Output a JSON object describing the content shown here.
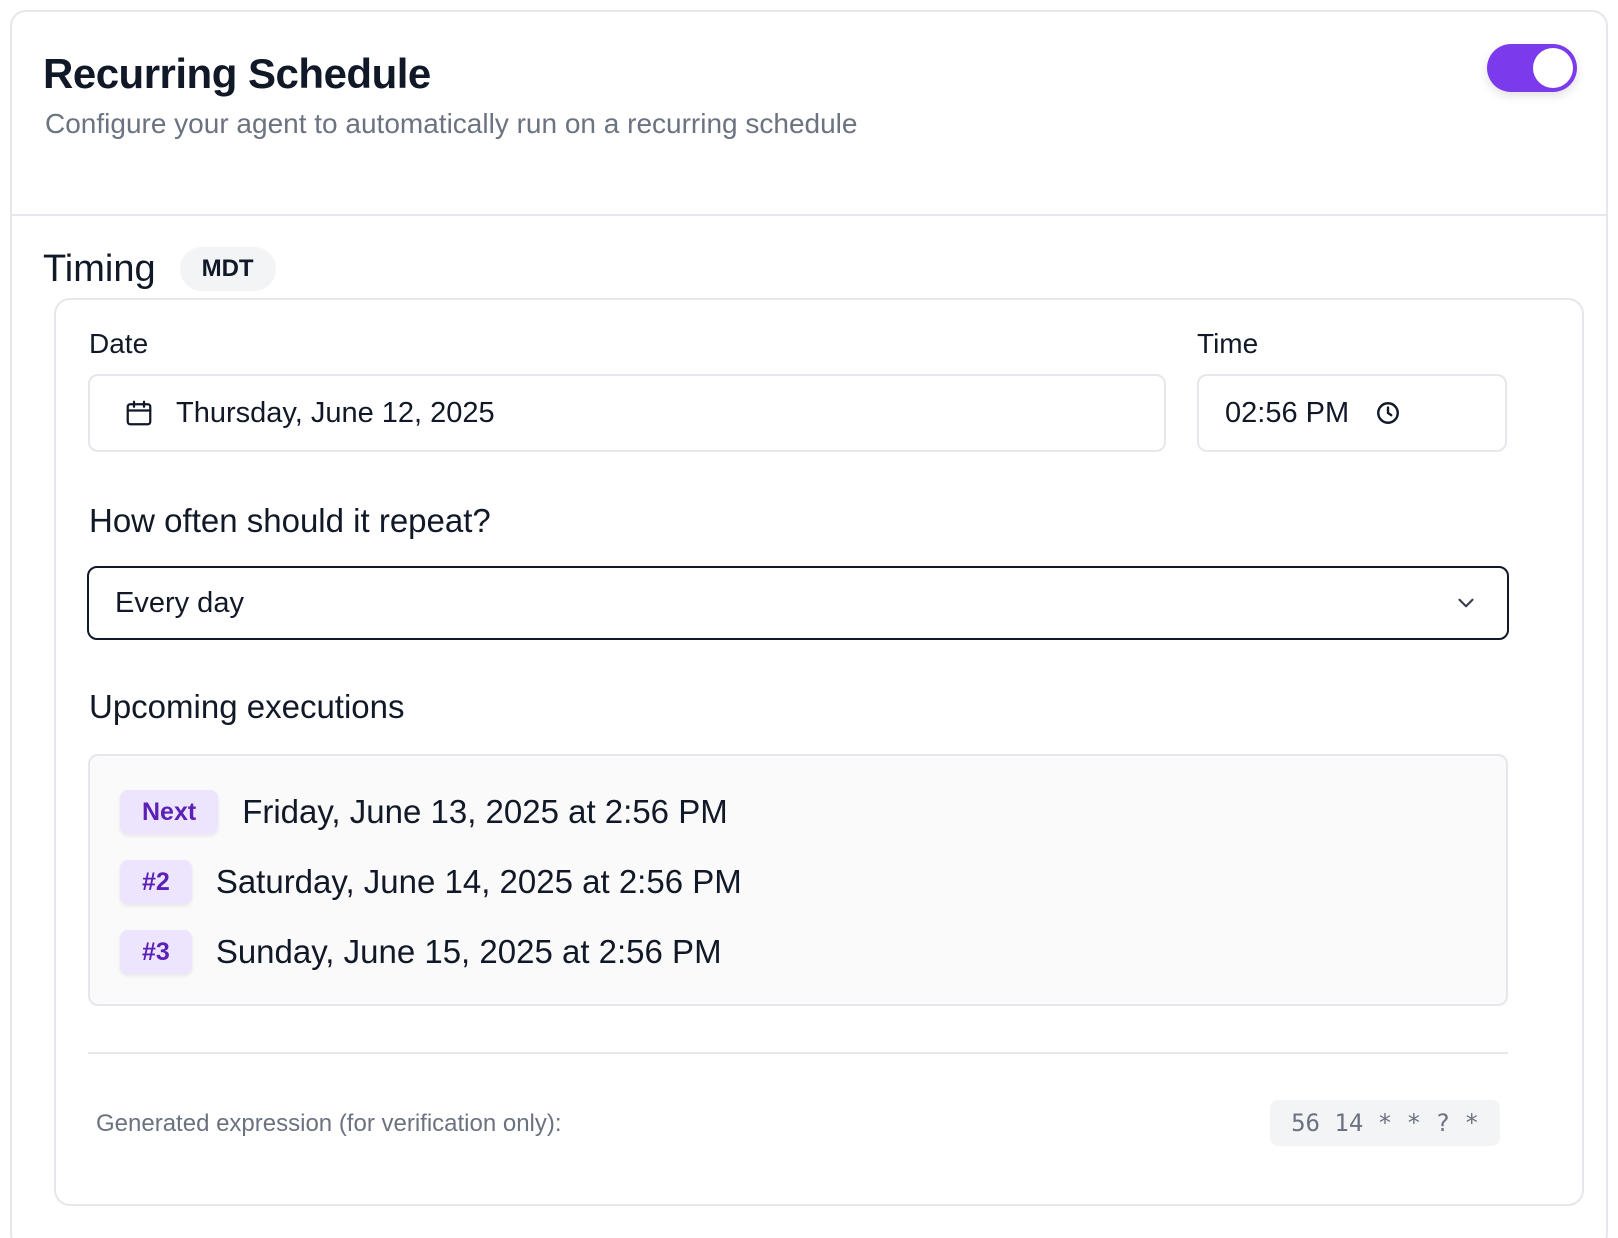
{
  "header": {
    "title": "Recurring Schedule",
    "subtitle": "Configure your agent to automatically run on a recurring schedule",
    "toggle_enabled": true,
    "accent_color": "#7c3aed"
  },
  "timing": {
    "label": "Timing",
    "timezone": "MDT"
  },
  "date_field": {
    "label": "Date",
    "value": "Thursday, June 12, 2025",
    "icon": "calendar-icon"
  },
  "time_field": {
    "label": "Time",
    "value": "02:56 PM",
    "icon": "clock-icon"
  },
  "repeat": {
    "label": "How often should it repeat?",
    "selected": "Every day",
    "icon": "chevron-down-icon"
  },
  "upcoming": {
    "label": "Upcoming executions",
    "items": [
      {
        "badge": "Next",
        "text": "Friday, June 13, 2025 at 2:56 PM"
      },
      {
        "badge": "#2",
        "text": "Saturday, June 14, 2025 at 2:56 PM"
      },
      {
        "badge": "#3",
        "text": "Sunday, June 15, 2025 at 2:56 PM"
      }
    ]
  },
  "expression": {
    "label": "Generated expression (for verification only):",
    "value": "56 14 * * ? *"
  }
}
